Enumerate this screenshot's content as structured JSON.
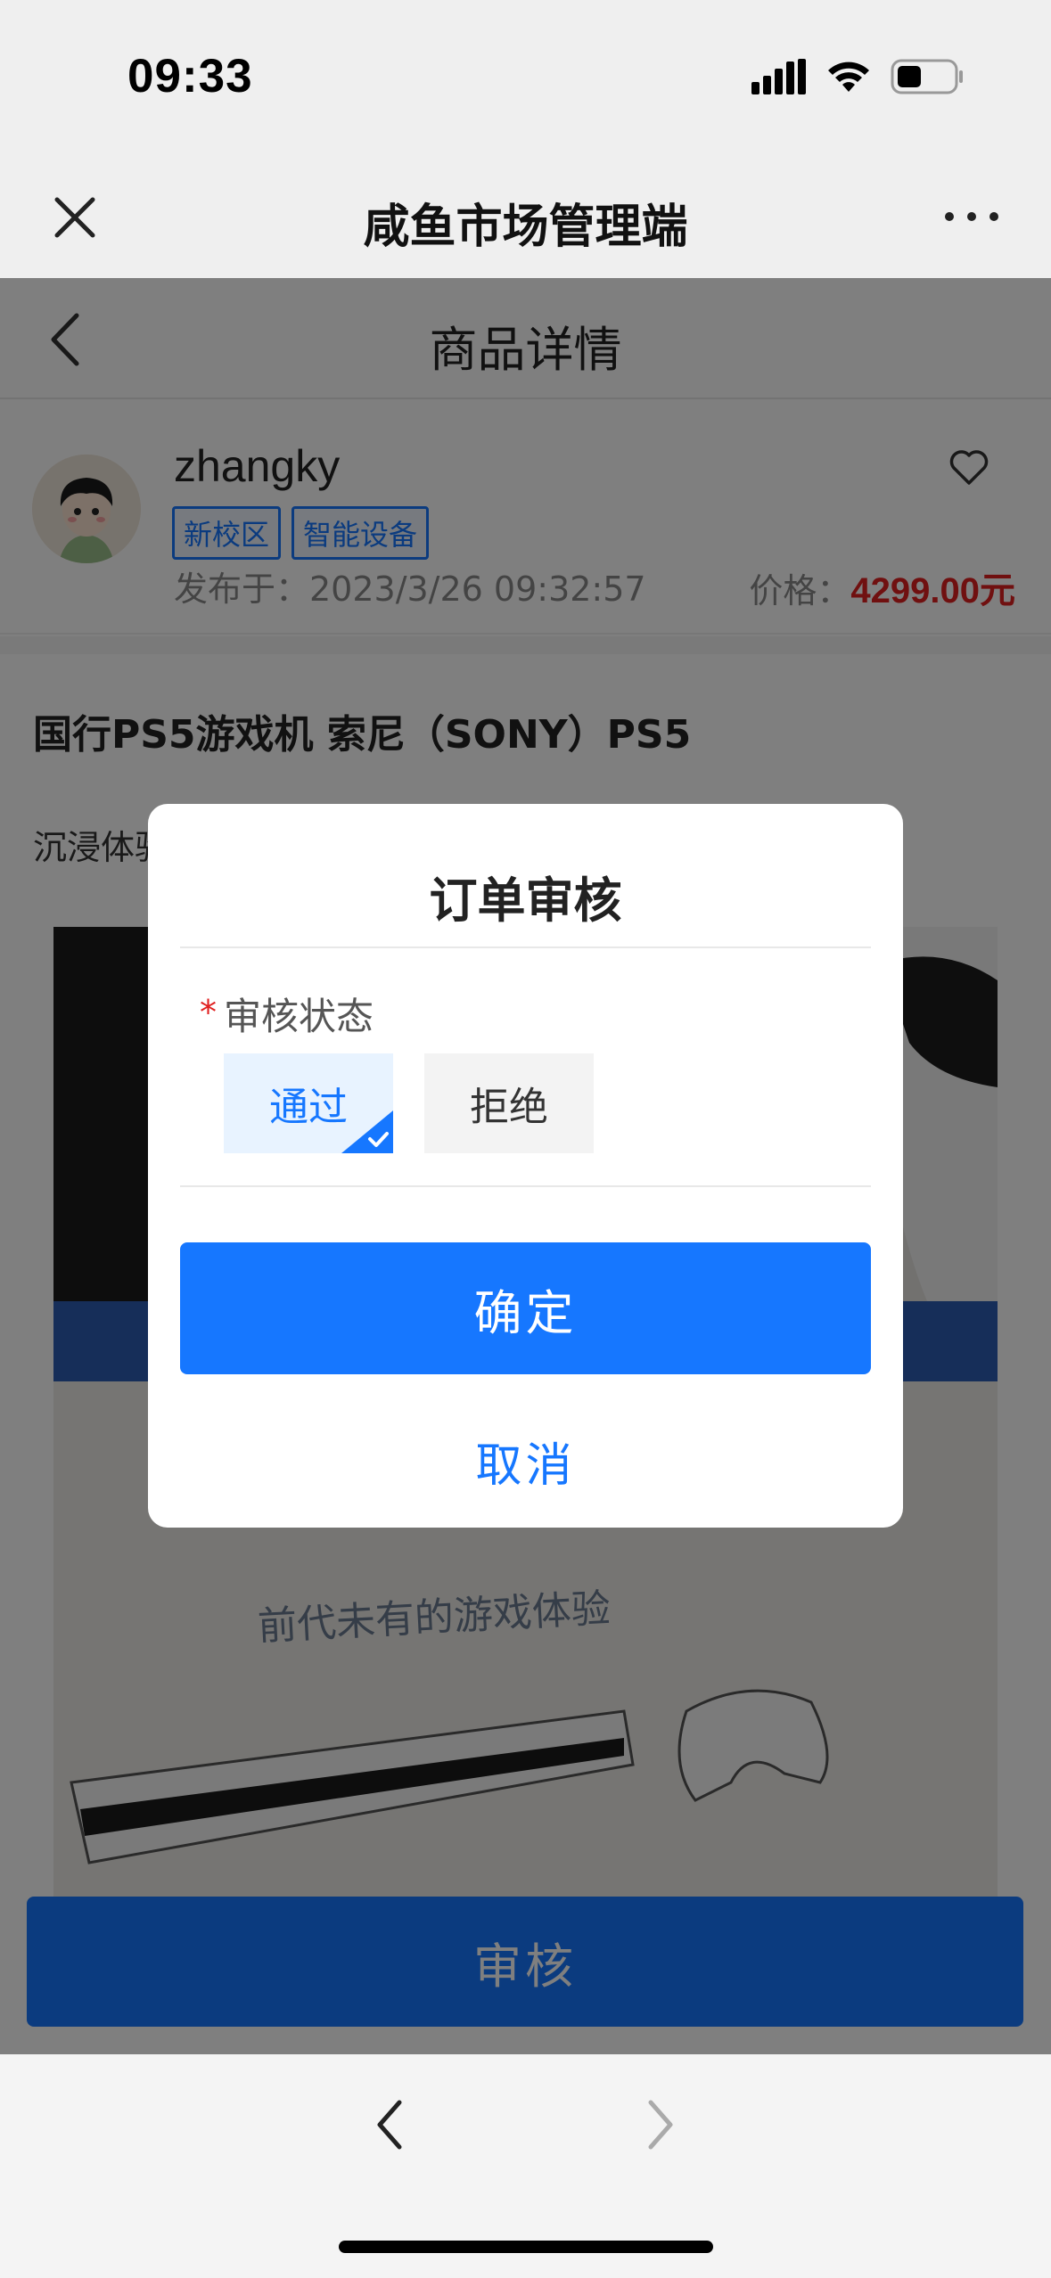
{
  "status_bar": {
    "time": "09:33"
  },
  "app_header": {
    "title": "咸鱼市场管理端"
  },
  "navbar": {
    "title": "商品详情"
  },
  "seller": {
    "username": "zhangky",
    "tags": [
      "新校区",
      "智能设备"
    ],
    "published": "发布于：2023/3/26 09:32:57",
    "price_label": "价格：",
    "price_value": "4299.00元"
  },
  "product": {
    "title": "国行PS5游戏机 索尼（SONY）PS5",
    "description": "沉浸体验",
    "photo_caption": "前代未有的游戏体验"
  },
  "bottom_button": {
    "label": "审核"
  },
  "dialog": {
    "title": "订单审核",
    "field_label": "审核状态",
    "required_mark": "*",
    "options": [
      "通过",
      "拒绝"
    ],
    "selected": "通过",
    "confirm_label": "确定",
    "cancel_label": "取消"
  },
  "colors": {
    "accent": "#1677ff",
    "price": "#e02020",
    "overlay": "rgba(0,0,0,0.5)"
  }
}
